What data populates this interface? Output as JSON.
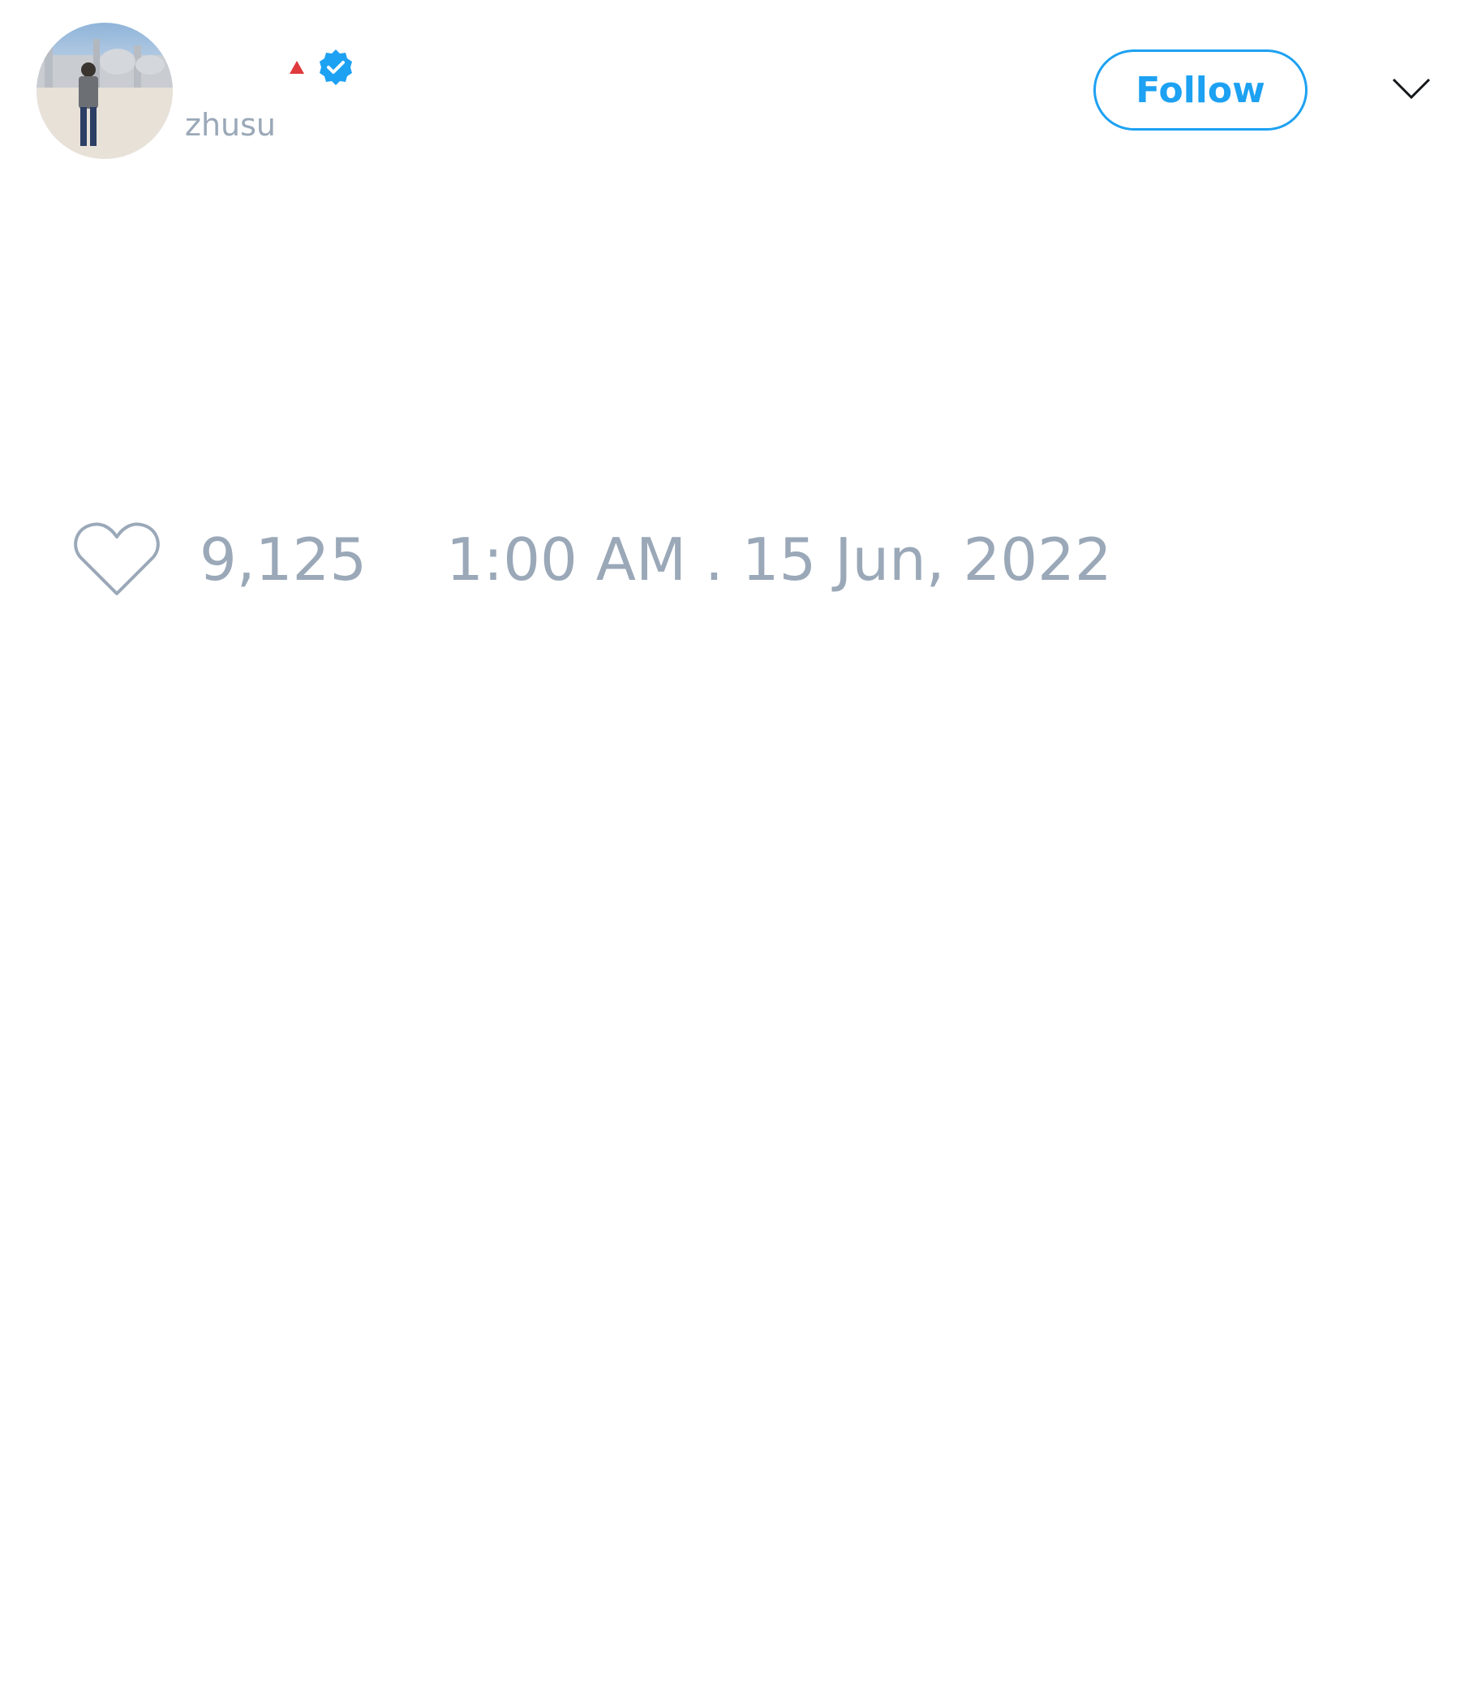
{
  "tweet": {
    "author": {
      "display_name": "",
      "handle": "zhusu",
      "avatar_icon": "profile-photo",
      "flag_icon": "red-triangle-icon",
      "verified_icon": "verified-badge-icon"
    },
    "follow_label": "Follow",
    "menu_icon": "chevron-down-icon",
    "likes": "9,125",
    "like_icon": "heart-icon",
    "timestamp": "1:00 AM . 15 Jun, 2022"
  },
  "colors": {
    "accent": "#1da1f2",
    "muted_text": "#9aa8b8",
    "flag_red": "#e0393e",
    "background": "#ffffff"
  }
}
